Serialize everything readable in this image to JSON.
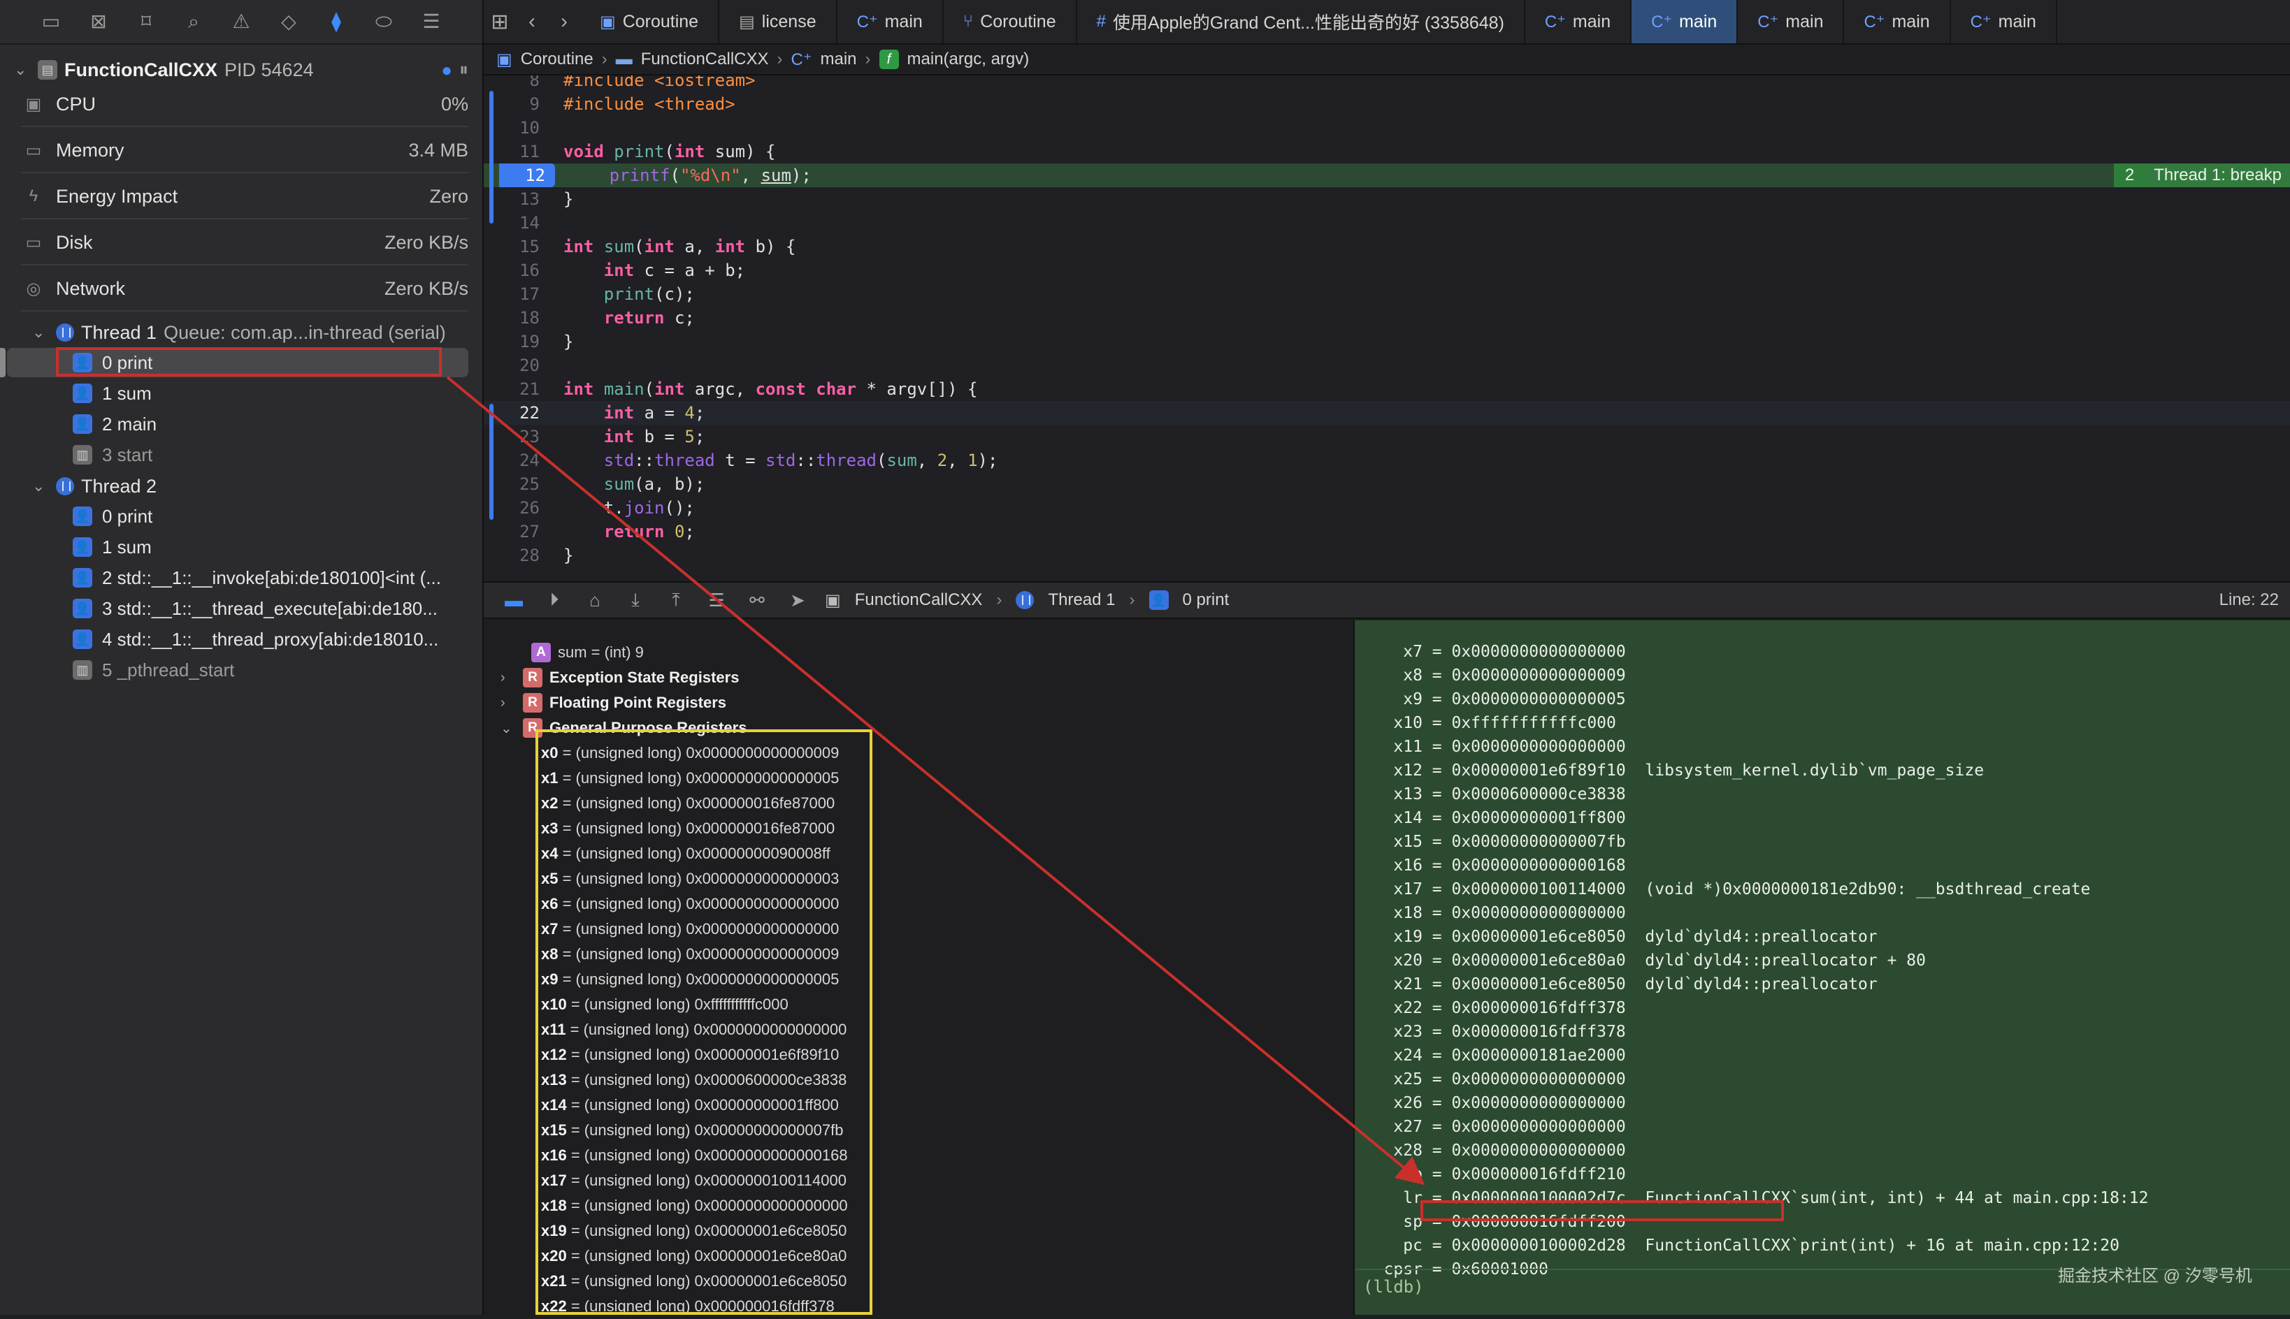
{
  "navigator": {
    "process_name": "FunctionCallCXX",
    "pid": "PID 54624",
    "gauges": [
      {
        "label": "CPU",
        "value": "0%",
        "icon": "cpu-icon"
      },
      {
        "label": "Memory",
        "value": "3.4 MB",
        "icon": "memory-icon"
      },
      {
        "label": "Energy Impact",
        "value": "Zero",
        "icon": "energy-icon"
      },
      {
        "label": "Disk",
        "value": "Zero KB/s",
        "icon": "disk-icon"
      },
      {
        "label": "Network",
        "value": "Zero KB/s",
        "icon": "network-icon"
      }
    ],
    "thread1": {
      "label": "Thread 1",
      "queue": "Queue: com.ap...in-thread (serial)",
      "frames": [
        "0 print",
        "1 sum",
        "2 main",
        "3 start"
      ]
    },
    "thread2": {
      "label": "Thread 2",
      "frames": [
        "0 print",
        "1 sum",
        "2 std::__1::__invoke[abi:de180100]<int (...",
        "3 std::__1::__thread_execute[abi:de180...",
        "4 std::__1::__thread_proxy[abi:de18010...",
        "5 _pthread_start"
      ]
    }
  },
  "tabs": [
    {
      "label": "Coroutine",
      "icon": "project-icon",
      "active": false
    },
    {
      "label": "license",
      "icon": "document-icon",
      "active": false
    },
    {
      "label": "main",
      "icon": "cpp-file-icon",
      "active": false
    },
    {
      "label": "Coroutine",
      "icon": "branch-icon",
      "active": false
    },
    {
      "label": "使用Apple的Grand Cent...性能出奇的好 (3358648)",
      "icon": "hash-icon",
      "active": false
    },
    {
      "label": "main",
      "icon": "cpp-file-icon",
      "active": false
    },
    {
      "label": "main",
      "icon": "cpp-file-icon",
      "active": true
    },
    {
      "label": "main",
      "icon": "cpp-file-icon",
      "active": false
    },
    {
      "label": "main",
      "icon": "cpp-file-icon",
      "active": false
    },
    {
      "label": "main",
      "icon": "cpp-file-icon",
      "active": false
    }
  ],
  "jumpbar": [
    "Coroutine",
    "FunctionCallCXX",
    "main",
    "main(argc, argv)"
  ],
  "breakpoint_badge": {
    "count": "2",
    "message": "Thread 1: breakp"
  },
  "debugbar": {
    "path": [
      "FunctionCallCXX",
      "Thread 1",
      "0 print"
    ],
    "line_info": "Line: 22"
  },
  "variables": {
    "sum": "sum = (int) 9",
    "groups": [
      "Exception State Registers",
      "Floating Point Registers",
      "General Purpose Registers"
    ],
    "registers": [
      [
        "x0",
        " = (unsigned long) 0x0000000000000009"
      ],
      [
        "x1",
        " = (unsigned long) 0x0000000000000005"
      ],
      [
        "x2",
        " = (unsigned long) 0x000000016fe87000"
      ],
      [
        "x3",
        " = (unsigned long) 0x000000016fe87000"
      ],
      [
        "x4",
        " = (unsigned long) 0x00000000090008ff"
      ],
      [
        "x5",
        " = (unsigned long) 0x0000000000000003"
      ],
      [
        "x6",
        " = (unsigned long) 0x0000000000000000"
      ],
      [
        "x7",
        " = (unsigned long) 0x0000000000000000"
      ],
      [
        "x8",
        " = (unsigned long) 0x0000000000000009"
      ],
      [
        "x9",
        " = (unsigned long) 0x0000000000000005"
      ],
      [
        "x10",
        " = (unsigned long) 0xfffffffffffc000"
      ],
      [
        "x11",
        " = (unsigned long) 0x0000000000000000"
      ],
      [
        "x12",
        " = (unsigned long) 0x00000001e6f89f10"
      ],
      [
        "x13",
        " = (unsigned long) 0x0000600000ce3838"
      ],
      [
        "x14",
        " = (unsigned long) 0x00000000001ff800"
      ],
      [
        "x15",
        " = (unsigned long) 0x00000000000007fb"
      ],
      [
        "x16",
        " = (unsigned long) 0x0000000000000168"
      ],
      [
        "x17",
        " = (unsigned long) 0x0000000100114000"
      ],
      [
        "x18",
        " = (unsigned long) 0x0000000000000000"
      ],
      [
        "x19",
        " = (unsigned long) 0x00000001e6ce8050"
      ],
      [
        "x20",
        " = (unsigned long) 0x00000001e6ce80a0"
      ],
      [
        "x21",
        " = (unsigned long) 0x00000001e6ce8050"
      ],
      [
        "x22",
        " = (unsigned long) 0x000000016fdff378"
      ]
    ]
  },
  "console": [
    "     x7 = 0x0000000000000000",
    "     x8 = 0x0000000000000009",
    "     x9 = 0x0000000000000005",
    "    x10 = 0xfffffffffffc000",
    "    x11 = 0x0000000000000000",
    "    x12 = 0x00000001e6f89f10  libsystem_kernel.dylib`vm_page_size",
    "    x13 = 0x0000600000ce3838",
    "    x14 = 0x00000000001ff800",
    "    x15 = 0x00000000000007fb",
    "    x16 = 0x0000000000000168",
    "    x17 = 0x0000000100114000  (void *)0x0000000181e2db90: __bsdthread_create",
    "    x18 = 0x0000000000000000",
    "    x19 = 0x00000001e6ce8050  dyld`dyld4::preallocator",
    "    x20 = 0x00000001e6ce80a0  dyld`dyld4::preallocator + 80",
    "    x21 = 0x00000001e6ce8050  dyld`dyld4::preallocator",
    "    x22 = 0x000000016fdff378",
    "    x23 = 0x000000016fdff378",
    "    x24 = 0x0000000181ae2000",
    "    x25 = 0x0000000000000000",
    "    x26 = 0x0000000000000000",
    "    x27 = 0x0000000000000000",
    "    x28 = 0x0000000000000000",
    "     fp = 0x000000016fdff210",
    "     lr = 0x0000000100002d7c  FunctionCallCXX`sum(int, int) + 44 at main.cpp:18:12",
    "     sp = 0x000000016fdff200",
    "     pc = 0x0000000100002d28  FunctionCallCXX`print(int) + 16 at main.cpp:12:20",
    "   cpsr = 0x60001000"
  ],
  "console_prompt": "(lldb)",
  "watermark": "掘金技术社区 @ 汐零号机"
}
